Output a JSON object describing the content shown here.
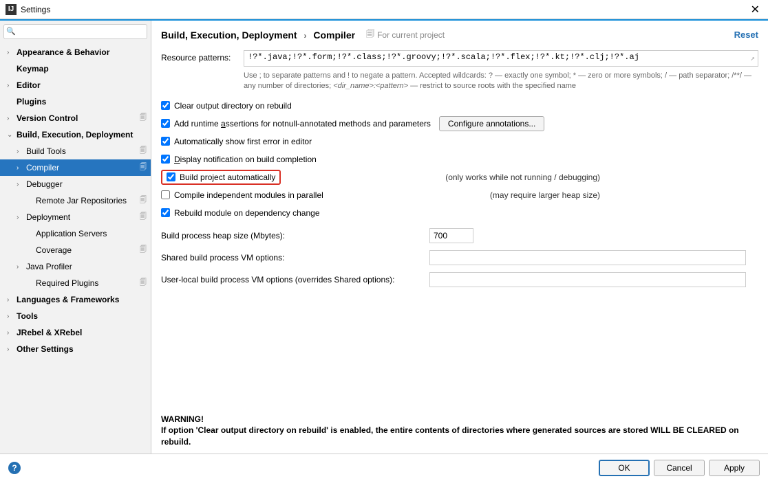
{
  "title": "Settings",
  "search_placeholder": "",
  "sidebar": [
    {
      "label": "Appearance & Behavior",
      "depth": 0,
      "chev": "›",
      "bold": true
    },
    {
      "label": "Keymap",
      "depth": 0,
      "chev": "",
      "bold": true
    },
    {
      "label": "Editor",
      "depth": 0,
      "chev": "›",
      "bold": true
    },
    {
      "label": "Plugins",
      "depth": 0,
      "chev": "",
      "bold": true
    },
    {
      "label": "Version Control",
      "depth": 0,
      "chev": "›",
      "bold": true,
      "proj": true
    },
    {
      "label": "Build, Execution, Deployment",
      "depth": 0,
      "chev": "⌄",
      "bold": true
    },
    {
      "label": "Build Tools",
      "depth": 1,
      "chev": "›",
      "proj": true
    },
    {
      "label": "Compiler",
      "depth": 1,
      "chev": "›",
      "selected": true,
      "proj": true
    },
    {
      "label": "Debugger",
      "depth": 1,
      "chev": "›"
    },
    {
      "label": "Remote Jar Repositories",
      "depth": 2,
      "chev": "",
      "proj": true
    },
    {
      "label": "Deployment",
      "depth": 1,
      "chev": "›",
      "proj": true
    },
    {
      "label": "Application Servers",
      "depth": 2,
      "chev": ""
    },
    {
      "label": "Coverage",
      "depth": 2,
      "chev": "",
      "proj": true
    },
    {
      "label": "Java Profiler",
      "depth": 1,
      "chev": "›"
    },
    {
      "label": "Required Plugins",
      "depth": 2,
      "chev": "",
      "proj": true
    },
    {
      "label": "Languages & Frameworks",
      "depth": 0,
      "chev": "›",
      "bold": true
    },
    {
      "label": "Tools",
      "depth": 0,
      "chev": "›",
      "bold": true
    },
    {
      "label": "JRebel & XRebel",
      "depth": 0,
      "chev": "›",
      "bold": true
    },
    {
      "label": "Other Settings",
      "depth": 0,
      "chev": "›",
      "bold": true
    }
  ],
  "breadcrumb": {
    "a": "Build, Execution, Deployment",
    "b": "Compiler"
  },
  "scope": "For current project",
  "reset": "Reset",
  "resource": {
    "label": "Resource patterns:",
    "value": "!?*.java;!?*.form;!?*.class;!?*.groovy;!?*.scala;!?*.flex;!?*.kt;!?*.clj;!?*.aj",
    "hint_a": "Use ; to separate patterns and ! to negate a pattern. Accepted wildcards: ? — exactly one symbol; * — zero or more symbols; / — path separator; /**/ — any number of directories; ",
    "hint_b": "<dir_name>:<pattern>",
    "hint_c": " — restrict to source roots with the specified name"
  },
  "checks": {
    "clear": "Clear output directory on rebuild",
    "assertions_pre": "Add runtime ",
    "assertions_u": "a",
    "assertions_post": "ssertions for notnull-annotated methods and parameters",
    "configure": "Configure annotations...",
    "firsterr": "Automatically show first error in editor",
    "display_u": "D",
    "display_post": "isplay notification on build completion",
    "auto": "Build project automatically",
    "auto_note": "(only works while not running / debugging)",
    "parallel": "Compile independent modules in parallel",
    "parallel_note": "(may require larger heap size)",
    "rebuild_dep": "Rebuild module on dependency change"
  },
  "fields": {
    "heap_label": "Build process heap size (Mbytes):",
    "heap_value": "700",
    "shared_label": "Shared build process VM options:",
    "shared_value": "",
    "user_label": "User-local build process VM options (overrides Shared options):",
    "user_value": ""
  },
  "warning": {
    "title": "WARNING!",
    "body": "If option 'Clear output directory on rebuild' is enabled, the entire contents of directories where generated sources are stored WILL BE CLEARED on rebuild."
  },
  "buttons": {
    "ok": "OK",
    "cancel": "Cancel",
    "apply": "Apply"
  }
}
